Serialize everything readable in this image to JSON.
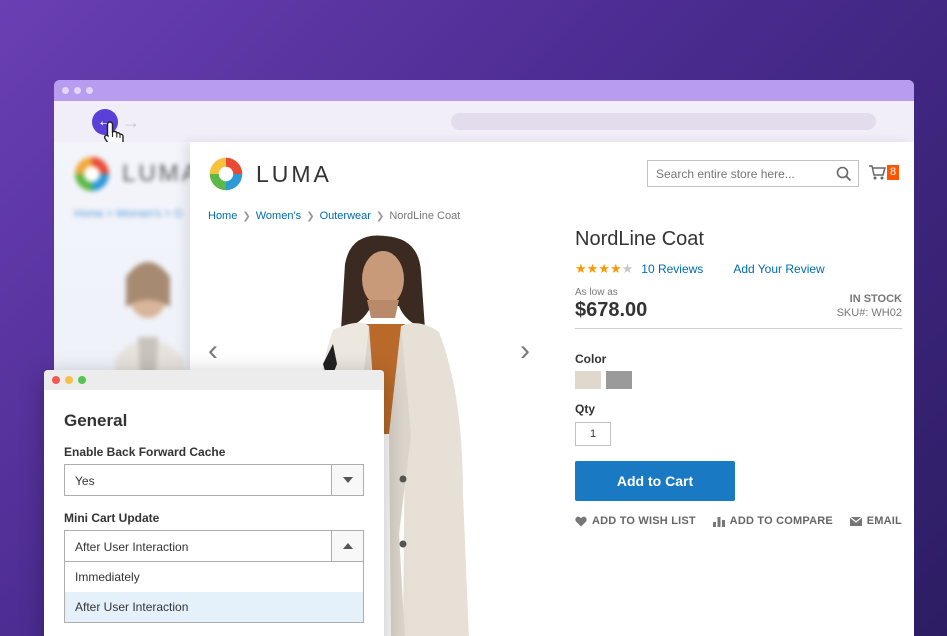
{
  "store": {
    "logo_text": "LUMA",
    "search_placeholder": "Search entire store here...",
    "cart_count": "8"
  },
  "breadcrumb": [
    "Home",
    "Women’s",
    "Outerwear",
    "NordLine Coat"
  ],
  "prev_page": {
    "logo_text": "LUMA",
    "breadcrumb": "Home  >  Women's  >  O"
  },
  "product": {
    "title": "NordLine Coat",
    "rating_stars": 4,
    "reviews_link": "10 Reviews",
    "add_review_link": "Add Your Review",
    "as_low_as": "As low as",
    "price": "$678.00",
    "stock": "IN STOCK",
    "sku": "SKU#: WH02",
    "color_label": "Color",
    "colors": [
      "#e0d8cc",
      "#9a9a9a"
    ],
    "qty_label": "Qty",
    "qty_value": "1",
    "add_to_cart": "Add to Cart",
    "actions": {
      "wishlist": "ADD TO WISH LIST",
      "compare": "ADD TO COMPARE",
      "email": "EMAIL"
    }
  },
  "admin": {
    "section_title": "General",
    "back_forward_label": "Enable Back Forward Cache",
    "back_forward_value": "Yes",
    "mini_cart_label": "Mini Cart Update",
    "mini_cart_value": "After User Interaction",
    "mini_cart_options": [
      "Immediately",
      "After User Interaction"
    ]
  },
  "colors": {
    "accent_blue": "#1979c3",
    "link_blue": "#006bb4",
    "star_orange": "#ff9900",
    "cart_badge": "#ff5501",
    "nav_back": "#5a3fd8",
    "option_highlight": "#e4f1fb"
  }
}
